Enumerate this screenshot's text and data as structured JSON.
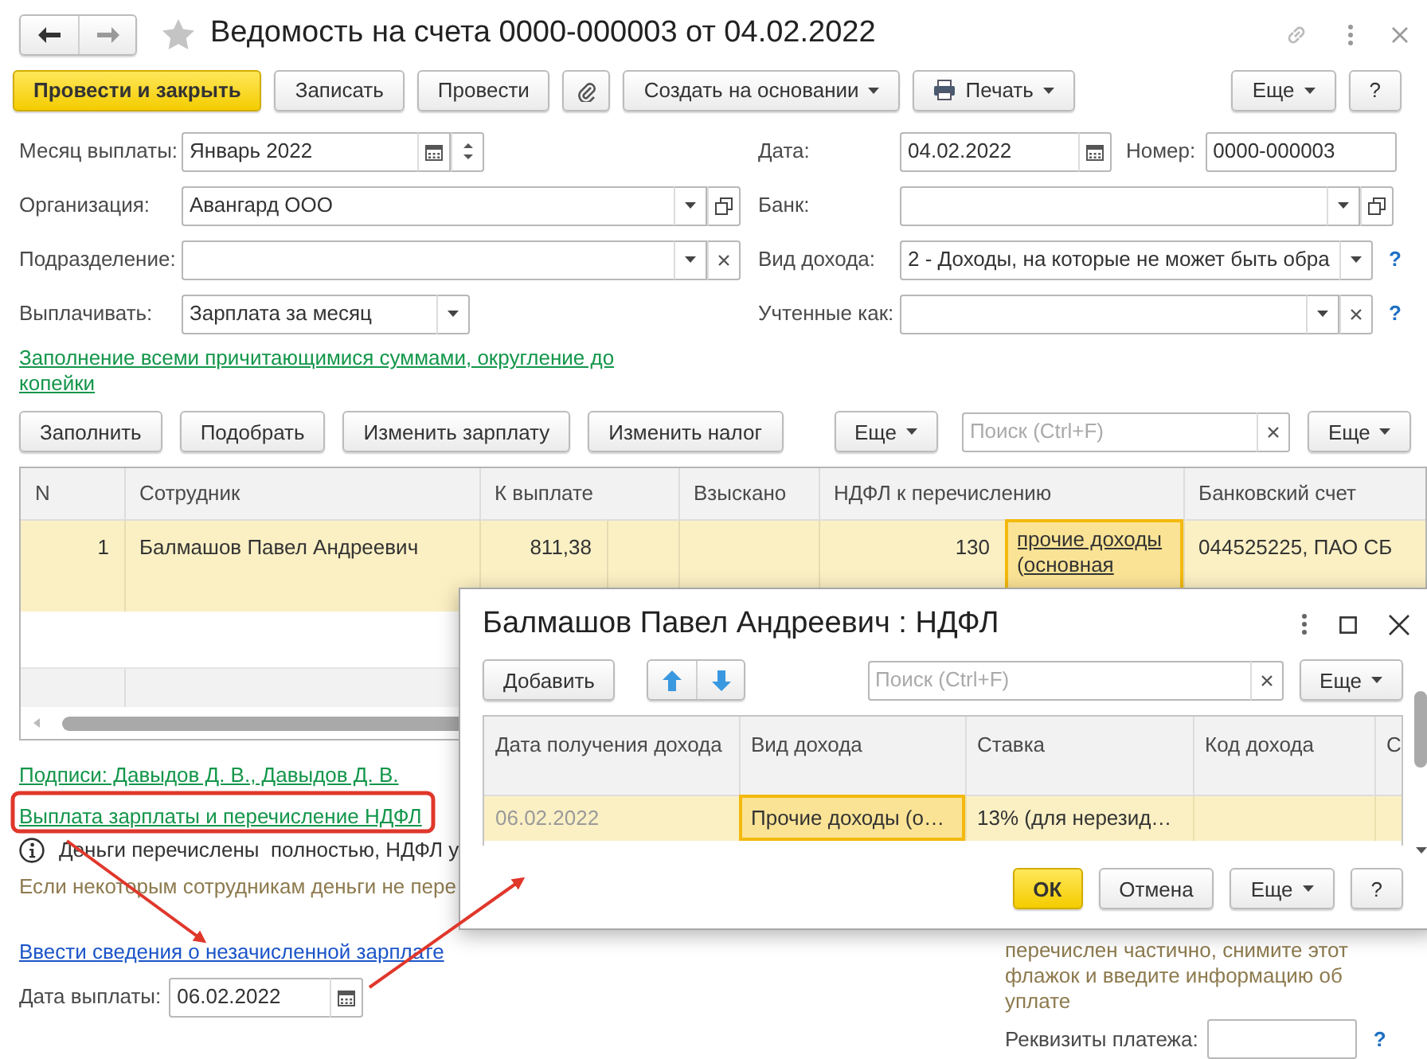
{
  "window": {
    "title": "Ведомость на счета 0000-000003 от 04.02.2022"
  },
  "toolbar": [
    {
      "kind": "primary",
      "label": "Провести и закрыть"
    },
    {
      "kind": "plain",
      "label": "Записать"
    },
    {
      "kind": "plain",
      "label": "Провести"
    },
    {
      "kind": "attach"
    },
    {
      "kind": "menu",
      "label": "Создать на основании"
    },
    {
      "kind": "print",
      "label": "Печать"
    },
    {
      "kind": "menu",
      "label": "Еще"
    },
    {
      "kind": "plain",
      "label": "?"
    }
  ],
  "fields_left": [
    {
      "label": "Месяц выплаты:",
      "value": "Январь 2022",
      "kind": "month"
    },
    {
      "label": "Организация:",
      "value": "Авангард ООО",
      "kind": "reference"
    },
    {
      "label": "Подразделение:",
      "kind": "clearable"
    },
    {
      "label": "Выплачивать:",
      "value": "Зарплата за месяц",
      "kind": "select"
    }
  ],
  "fields_right": [
    {
      "label": "Дата:",
      "value": "04.02.2022",
      "kind": "date",
      "extra": {
        "label": "Номер:",
        "value": "0000-000003"
      }
    },
    {
      "label": "Банк:",
      "kind": "reference"
    },
    {
      "label": "Вид дохода:",
      "value": "2 - Доходы, на которые не может быть обра",
      "kind": "select",
      "help": "?"
    },
    {
      "label": "Учтенные как:",
      "kind": "clearable",
      "help": "?"
    }
  ],
  "fill_link": "Заполнение всеми причитающимися суммами, округление до копейки",
  "table_toolbar": {
    "buttons": [
      "Заполнить",
      "Подобрать",
      "Изменить зарплату",
      "Изменить налог"
    ],
    "more": "Еще",
    "search_placeholder": "Поиск (Ctrl+F)",
    "more_right": "Еще"
  },
  "table": {
    "columns": [
      "N",
      "Сотрудник",
      "К выплате",
      "Взыскано",
      "НДФЛ к перечислению",
      "Банковский счет"
    ],
    "rows": [
      {
        "selected": true,
        "number": "1",
        "employee": "Балмашов Павел Андреевич",
        "to_pay": "811,38",
        "ndfl": "130",
        "income_link": "прочие доходы (основная",
        "bank_account": "044525225, ПАО СБ",
        "income_link_focused": true
      }
    ]
  },
  "signatures_link": "Подписи: Давыдов Д. В., Давыдов Д. В.",
  "payment_link": "Выплата зарплаты и перечисление НДФЛ",
  "info_message": "Деньги перечислены  полностью, НДФЛ у",
  "hint_left": "Если некоторым сотрудникам деньги не пере",
  "unpaid_link": "Ввести сведения о незачисленной зарплате",
  "payment_date": {
    "label": "Дата выплаты:",
    "value": "06.02.2022"
  },
  "hint_right": "перечислен частично, снимите этот флажок и введите информацию об уплате",
  "payment_details": {
    "label": "Реквизиты платежа:",
    "help": "?"
  },
  "dialog": {
    "title": "Балмашов Павел Андреевич : НДФЛ",
    "add_button": "Добавить",
    "search_placeholder": "Поиск (Ctrl+F)",
    "more": "Еще",
    "columns": [
      "Дата получения дохода",
      "Вид дохода",
      "Ставка",
      "Код дохода",
      "С"
    ],
    "rows": [
      {
        "selected": true,
        "cells": [
          {
            "text": "06.02.2022",
            "disabled": true
          },
          {
            "text": "Прочие доходы (о…",
            "focused": true
          },
          {
            "text": "13% (для нерезид…"
          }
        ]
      }
    ],
    "buttons": [
      {
        "kind": "primary",
        "label": "ОК"
      },
      {
        "kind": "plain",
        "label": "Отмена"
      },
      {
        "kind": "menu",
        "label": "Еще"
      },
      {
        "kind": "plain",
        "label": "?"
      }
    ]
  }
}
